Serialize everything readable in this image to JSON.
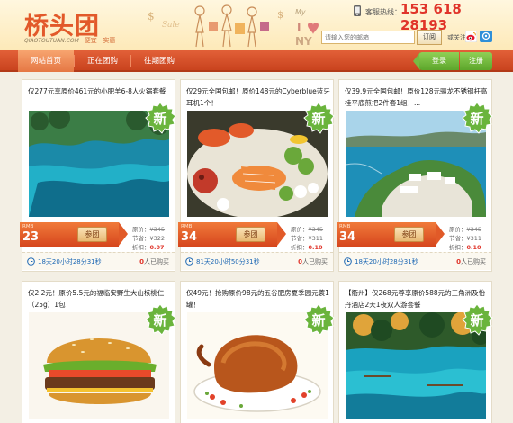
{
  "header": {
    "logo_text": "桥头团",
    "logo_domain": "QIAOTOUTUAN.COM",
    "logo_slogan": "便宜 · 实惠",
    "hotline_label": "客服热线：",
    "hotline_number": "153 618 28193",
    "email_placeholder": "请输入您的邮箱",
    "subscribe_label": "订阅",
    "follow_label": "或关注"
  },
  "nav": {
    "tabs": [
      {
        "label": "网站首页",
        "active": true
      },
      {
        "label": "正在团购",
        "active": false
      },
      {
        "label": "往期团购",
        "active": false
      }
    ],
    "login_label": "登录",
    "register_label": "注册"
  },
  "cards": [
    {
      "title": "仅277元享原价461元的小肥羊6-8人火锅套餐",
      "image": "lake-photo",
      "currency": "RMB",
      "price": "23",
      "buy_label": "参团",
      "original_label": "原价：",
      "original": "¥345",
      "saving_label": "节省：",
      "saving": "¥322",
      "discount_label": "折扣：",
      "discount": "0.07",
      "countdown": "18天20小时28分31秒",
      "bought_count": "0",
      "bought_label": "人已购买"
    },
    {
      "title": "仅29元全国包邮！原价148元的Cyberblue蓝牙耳机1个！",
      "image": "seafood-photo",
      "currency": "RMB",
      "price": "34",
      "buy_label": "参团",
      "original_label": "原价：",
      "original": "¥345",
      "saving_label": "节省：",
      "saving": "¥311",
      "discount_label": "折扣：",
      "discount": "0.10",
      "countdown": "81天20小时50分31秒",
      "bought_count": "0",
      "bought_label": "人已购买"
    },
    {
      "title": "仅39.9元全国包邮！原价128元骊龙不锈钢杆高桂平底煎把2件套1组！...",
      "image": "island-photo",
      "currency": "RMB",
      "price": "34",
      "buy_label": "参团",
      "original_label": "原价：",
      "original": "¥345",
      "saving_label": "节省：",
      "saving": "¥311",
      "discount_label": "折扣：",
      "discount": "0.10",
      "countdown": "18天20小时28分31秒",
      "bought_count": "0",
      "bought_label": "人已购买"
    },
    {
      "title": "仅2.2元！原价5.5元的福临安野生大山核桃仁（25g）1包",
      "image": "burger-photo"
    },
    {
      "title": "仅49元！抢购原价98元的五谷肥房夏季园元蓑1罐！",
      "image": "roast-duck-photo"
    },
    {
      "title": "【衢州】仅268元尊享原价588元的三角洲及怡丹酒店2天1夜双人游套餐",
      "image": "lake-photo-2"
    }
  ],
  "new_badge_label": "新"
}
